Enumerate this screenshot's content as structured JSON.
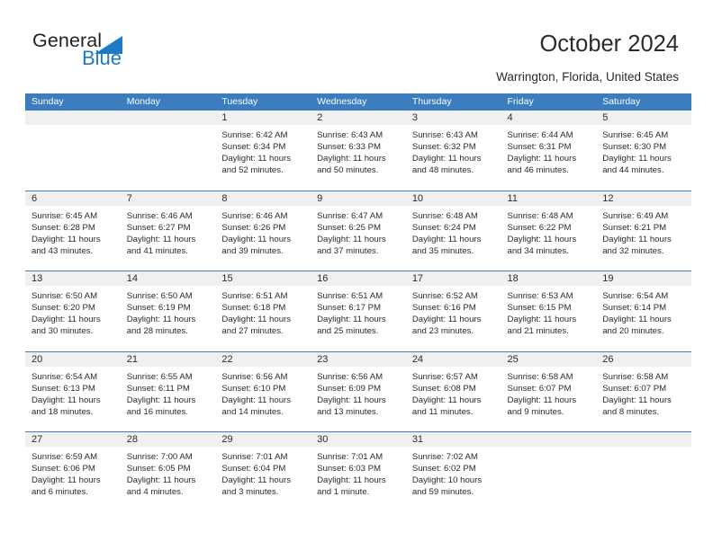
{
  "brand": {
    "name_top": "General",
    "name_bottom": "Blue",
    "triangle_icon": "blue-triangle-icon",
    "color_dark": "#231f20",
    "color_blue": "#1f7ac4"
  },
  "header": {
    "title": "October 2024",
    "location": "Warrington, Florida, United States"
  },
  "theme": {
    "header_blue": "#3b7dbe",
    "day_band_gray": "#f0f0f0",
    "text": "#2b2b2b"
  },
  "calendar": {
    "day_names": [
      "Sunday",
      "Monday",
      "Tuesday",
      "Wednesday",
      "Thursday",
      "Friday",
      "Saturday"
    ],
    "weeks": [
      [
        {
          "date": "",
          "sunrise": "",
          "sunset": "",
          "daylight_1": "",
          "daylight_2": ""
        },
        {
          "date": "",
          "sunrise": "",
          "sunset": "",
          "daylight_1": "",
          "daylight_2": ""
        },
        {
          "date": "1",
          "sunrise": "Sunrise: 6:42 AM",
          "sunset": "Sunset: 6:34 PM",
          "daylight_1": "Daylight: 11 hours",
          "daylight_2": "and 52 minutes."
        },
        {
          "date": "2",
          "sunrise": "Sunrise: 6:43 AM",
          "sunset": "Sunset: 6:33 PM",
          "daylight_1": "Daylight: 11 hours",
          "daylight_2": "and 50 minutes."
        },
        {
          "date": "3",
          "sunrise": "Sunrise: 6:43 AM",
          "sunset": "Sunset: 6:32 PM",
          "daylight_1": "Daylight: 11 hours",
          "daylight_2": "and 48 minutes."
        },
        {
          "date": "4",
          "sunrise": "Sunrise: 6:44 AM",
          "sunset": "Sunset: 6:31 PM",
          "daylight_1": "Daylight: 11 hours",
          "daylight_2": "and 46 minutes."
        },
        {
          "date": "5",
          "sunrise": "Sunrise: 6:45 AM",
          "sunset": "Sunset: 6:30 PM",
          "daylight_1": "Daylight: 11 hours",
          "daylight_2": "and 44 minutes."
        }
      ],
      [
        {
          "date": "6",
          "sunrise": "Sunrise: 6:45 AM",
          "sunset": "Sunset: 6:28 PM",
          "daylight_1": "Daylight: 11 hours",
          "daylight_2": "and 43 minutes."
        },
        {
          "date": "7",
          "sunrise": "Sunrise: 6:46 AM",
          "sunset": "Sunset: 6:27 PM",
          "daylight_1": "Daylight: 11 hours",
          "daylight_2": "and 41 minutes."
        },
        {
          "date": "8",
          "sunrise": "Sunrise: 6:46 AM",
          "sunset": "Sunset: 6:26 PM",
          "daylight_1": "Daylight: 11 hours",
          "daylight_2": "and 39 minutes."
        },
        {
          "date": "9",
          "sunrise": "Sunrise: 6:47 AM",
          "sunset": "Sunset: 6:25 PM",
          "daylight_1": "Daylight: 11 hours",
          "daylight_2": "and 37 minutes."
        },
        {
          "date": "10",
          "sunrise": "Sunrise: 6:48 AM",
          "sunset": "Sunset: 6:24 PM",
          "daylight_1": "Daylight: 11 hours",
          "daylight_2": "and 35 minutes."
        },
        {
          "date": "11",
          "sunrise": "Sunrise: 6:48 AM",
          "sunset": "Sunset: 6:22 PM",
          "daylight_1": "Daylight: 11 hours",
          "daylight_2": "and 34 minutes."
        },
        {
          "date": "12",
          "sunrise": "Sunrise: 6:49 AM",
          "sunset": "Sunset: 6:21 PM",
          "daylight_1": "Daylight: 11 hours",
          "daylight_2": "and 32 minutes."
        }
      ],
      [
        {
          "date": "13",
          "sunrise": "Sunrise: 6:50 AM",
          "sunset": "Sunset: 6:20 PM",
          "daylight_1": "Daylight: 11 hours",
          "daylight_2": "and 30 minutes."
        },
        {
          "date": "14",
          "sunrise": "Sunrise: 6:50 AM",
          "sunset": "Sunset: 6:19 PM",
          "daylight_1": "Daylight: 11 hours",
          "daylight_2": "and 28 minutes."
        },
        {
          "date": "15",
          "sunrise": "Sunrise: 6:51 AM",
          "sunset": "Sunset: 6:18 PM",
          "daylight_1": "Daylight: 11 hours",
          "daylight_2": "and 27 minutes."
        },
        {
          "date": "16",
          "sunrise": "Sunrise: 6:51 AM",
          "sunset": "Sunset: 6:17 PM",
          "daylight_1": "Daylight: 11 hours",
          "daylight_2": "and 25 minutes."
        },
        {
          "date": "17",
          "sunrise": "Sunrise: 6:52 AM",
          "sunset": "Sunset: 6:16 PM",
          "daylight_1": "Daylight: 11 hours",
          "daylight_2": "and 23 minutes."
        },
        {
          "date": "18",
          "sunrise": "Sunrise: 6:53 AM",
          "sunset": "Sunset: 6:15 PM",
          "daylight_1": "Daylight: 11 hours",
          "daylight_2": "and 21 minutes."
        },
        {
          "date": "19",
          "sunrise": "Sunrise: 6:54 AM",
          "sunset": "Sunset: 6:14 PM",
          "daylight_1": "Daylight: 11 hours",
          "daylight_2": "and 20 minutes."
        }
      ],
      [
        {
          "date": "20",
          "sunrise": "Sunrise: 6:54 AM",
          "sunset": "Sunset: 6:13 PM",
          "daylight_1": "Daylight: 11 hours",
          "daylight_2": "and 18 minutes."
        },
        {
          "date": "21",
          "sunrise": "Sunrise: 6:55 AM",
          "sunset": "Sunset: 6:11 PM",
          "daylight_1": "Daylight: 11 hours",
          "daylight_2": "and 16 minutes."
        },
        {
          "date": "22",
          "sunrise": "Sunrise: 6:56 AM",
          "sunset": "Sunset: 6:10 PM",
          "daylight_1": "Daylight: 11 hours",
          "daylight_2": "and 14 minutes."
        },
        {
          "date": "23",
          "sunrise": "Sunrise: 6:56 AM",
          "sunset": "Sunset: 6:09 PM",
          "daylight_1": "Daylight: 11 hours",
          "daylight_2": "and 13 minutes."
        },
        {
          "date": "24",
          "sunrise": "Sunrise: 6:57 AM",
          "sunset": "Sunset: 6:08 PM",
          "daylight_1": "Daylight: 11 hours",
          "daylight_2": "and 11 minutes."
        },
        {
          "date": "25",
          "sunrise": "Sunrise: 6:58 AM",
          "sunset": "Sunset: 6:07 PM",
          "daylight_1": "Daylight: 11 hours",
          "daylight_2": "and 9 minutes."
        },
        {
          "date": "26",
          "sunrise": "Sunrise: 6:58 AM",
          "sunset": "Sunset: 6:07 PM",
          "daylight_1": "Daylight: 11 hours",
          "daylight_2": "and 8 minutes."
        }
      ],
      [
        {
          "date": "27",
          "sunrise": "Sunrise: 6:59 AM",
          "sunset": "Sunset: 6:06 PM",
          "daylight_1": "Daylight: 11 hours",
          "daylight_2": "and 6 minutes."
        },
        {
          "date": "28",
          "sunrise": "Sunrise: 7:00 AM",
          "sunset": "Sunset: 6:05 PM",
          "daylight_1": "Daylight: 11 hours",
          "daylight_2": "and 4 minutes."
        },
        {
          "date": "29",
          "sunrise": "Sunrise: 7:01 AM",
          "sunset": "Sunset: 6:04 PM",
          "daylight_1": "Daylight: 11 hours",
          "daylight_2": "and 3 minutes."
        },
        {
          "date": "30",
          "sunrise": "Sunrise: 7:01 AM",
          "sunset": "Sunset: 6:03 PM",
          "daylight_1": "Daylight: 11 hours",
          "daylight_2": "and 1 minute."
        },
        {
          "date": "31",
          "sunrise": "Sunrise: 7:02 AM",
          "sunset": "Sunset: 6:02 PM",
          "daylight_1": "Daylight: 10 hours",
          "daylight_2": "and 59 minutes."
        },
        {
          "date": "",
          "sunrise": "",
          "sunset": "",
          "daylight_1": "",
          "daylight_2": ""
        },
        {
          "date": "",
          "sunrise": "",
          "sunset": "",
          "daylight_1": "",
          "daylight_2": ""
        }
      ]
    ]
  }
}
